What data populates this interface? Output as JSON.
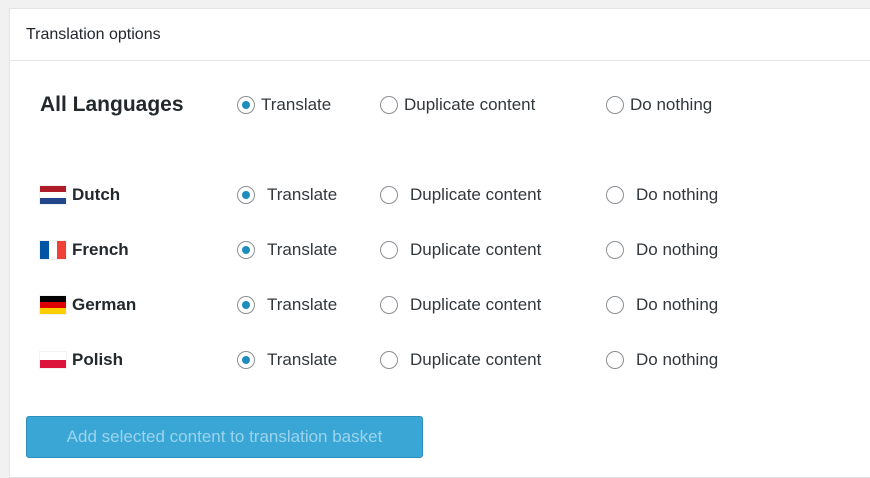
{
  "panel": {
    "title": "Translation options"
  },
  "all_languages": {
    "label": "All Languages",
    "options": [
      "Translate",
      "Duplicate content",
      "Do nothing"
    ],
    "selected": "Translate"
  },
  "languages": [
    {
      "name": "Dutch",
      "flag": "nl-flag-icon",
      "colors": [
        "#ae1c28",
        "#ffffff",
        "#21468b"
      ],
      "selected": "Translate"
    },
    {
      "name": "French",
      "flag": "fr-flag-icon",
      "colors": [
        "#0055a4",
        "#ffffff",
        "#ef4135"
      ],
      "selected": "Translate"
    },
    {
      "name": "German",
      "flag": "de-flag-icon",
      "colors": [
        "#000000",
        "#dd0000",
        "#ffce00"
      ],
      "selected": "Translate"
    },
    {
      "name": "Polish",
      "flag": "pl-flag-icon",
      "colors": [
        "#ffffff",
        "#dc143c"
      ],
      "selected": "Translate"
    }
  ],
  "options": {
    "translate": "Translate",
    "duplicate": "Duplicate content",
    "nothing": "Do nothing"
  },
  "button": {
    "label": "Add selected content to translation basket"
  },
  "colors": {
    "accent": "#1e8cbe",
    "button_bg": "#39a6d6",
    "button_text": "#9cd4ec"
  }
}
